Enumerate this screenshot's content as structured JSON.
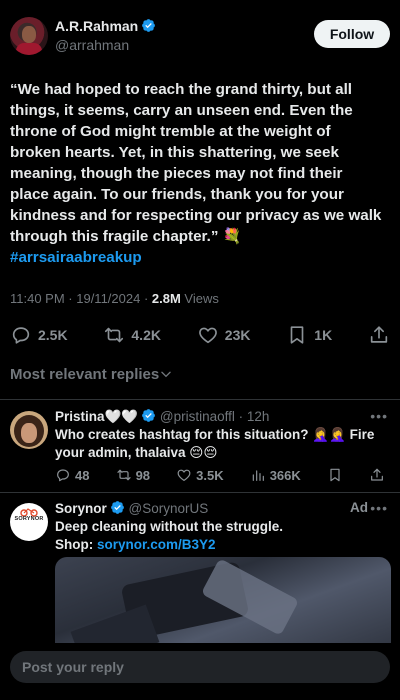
{
  "tweet": {
    "author_name": "A.R.Rahman",
    "author_handle": "@arrahman",
    "follow_label": "Follow",
    "text": "“We had hoped to reach the grand thirty, but all things, it seems, carry an unseen end. Even the throne of God might tremble at the weight of broken hearts. Yet, in this shattering, we seek meaning, though the pieces may not find their place again. To our friends, thank you for your kindness and for respecting our privacy as we walk through this fragile chapter.” 💐",
    "hashtag": "#arrsairaabreakup",
    "timestamp": "11:40 PM · 19/11/2024 · ",
    "views_count": "2.8M",
    "views_label": " Views",
    "stats": {
      "replies": "2.5K",
      "reposts": "4.2K",
      "likes": "23K",
      "bookmarks": "1K"
    }
  },
  "sort_label": "Most relevant replies",
  "reply": {
    "author_name": "Pristina🤍🤍",
    "author_handle": "@pristinaoffl",
    "time": "· 12h",
    "text": "Who creates hashtag for this situation? 🤦‍♀️🤦‍♀️ Fire your admin, thalaiva 😔😔",
    "stats": {
      "replies": "48",
      "reposts": "98",
      "likes": "3.5K",
      "views": "366K"
    }
  },
  "ad": {
    "author_name": "Sorynor",
    "author_handle": "@SorynorUS",
    "label": "Ad",
    "text": "Deep cleaning without the struggle.",
    "shop_label": "Shop: ",
    "shop_link": "sorynor.com/B3Y2",
    "avatar_logo_text": "SORYNOR"
  },
  "composer": {
    "placeholder": "Post your reply"
  },
  "icons": {
    "verified": "verified-badge-icon",
    "reply": "reply-icon",
    "repost": "repost-icon",
    "like": "heart-icon",
    "bookmark": "bookmark-icon",
    "share": "share-icon",
    "views": "views-icon",
    "more": "more-icon",
    "chevron": "chevron-down-icon"
  },
  "colors": {
    "background": "#000000",
    "text": "#e7e9ea",
    "muted": "#71767b",
    "link": "#1d9bf0",
    "verified": "#1d9bf0",
    "divider": "#2f3336"
  }
}
